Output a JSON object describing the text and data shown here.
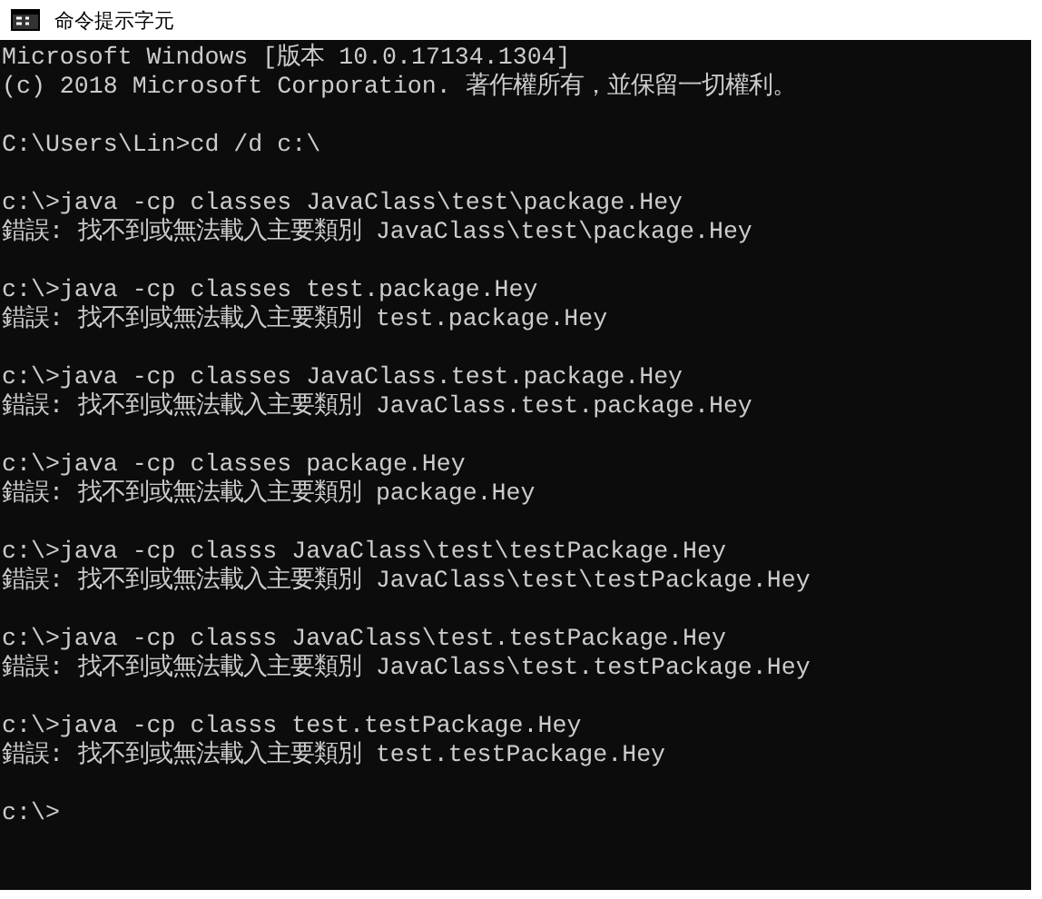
{
  "window": {
    "title": "命令提示字元"
  },
  "console": {
    "blocks": [
      {
        "lines": [
          "Microsoft Windows [版本 10.0.17134.1304]",
          "(c) 2018 Microsoft Corporation. 著作權所有，並保留一切權利。"
        ]
      },
      {
        "lines": [
          "C:\\Users\\Lin>cd /d c:\\"
        ]
      },
      {
        "lines": [
          "c:\\>java -cp classes JavaClass\\test\\package.Hey",
          "錯誤: 找不到或無法載入主要類別 JavaClass\\test\\package.Hey"
        ]
      },
      {
        "lines": [
          "c:\\>java -cp classes test.package.Hey",
          "錯誤: 找不到或無法載入主要類別 test.package.Hey"
        ]
      },
      {
        "lines": [
          "c:\\>java -cp classes JavaClass.test.package.Hey",
          "錯誤: 找不到或無法載入主要類別 JavaClass.test.package.Hey"
        ]
      },
      {
        "lines": [
          "c:\\>java -cp classes package.Hey",
          "錯誤: 找不到或無法載入主要類別 package.Hey"
        ]
      },
      {
        "lines": [
          "c:\\>java -cp classs JavaClass\\test\\testPackage.Hey",
          "錯誤: 找不到或無法載入主要類別 JavaClass\\test\\testPackage.Hey"
        ]
      },
      {
        "lines": [
          "c:\\>java -cp classs JavaClass\\test.testPackage.Hey",
          "錯誤: 找不到或無法載入主要類別 JavaClass\\test.testPackage.Hey"
        ]
      },
      {
        "lines": [
          "c:\\>java -cp classs test.testPackage.Hey",
          "錯誤: 找不到或無法載入主要類別 test.testPackage.Hey"
        ]
      },
      {
        "lines": [
          "c:\\>"
        ]
      }
    ]
  }
}
